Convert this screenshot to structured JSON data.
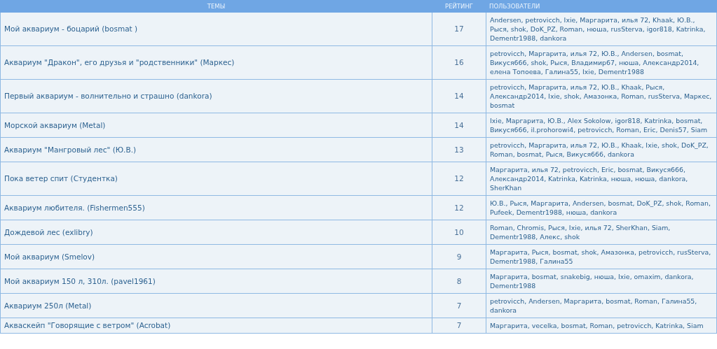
{
  "table": {
    "columns": [
      "ТЕМЫ",
      "РЕЙТИНГ",
      "ПОЛЬЗОВАТЕЛИ"
    ],
    "rows": [
      {
        "topic": "Мой аквариум - боцарий (bosmat )",
        "rating": "17",
        "users": "Andersen, petrovicch, Ixie, Маргарита, илья 72, Khaak, Ю.В., Рыся, shok, DoK_PZ, Roman, нюша, rusSterva, igor818, Katrinka, Dementr1988, dankora"
      },
      {
        "topic": "Аквариум \"Дракон\", его друзья и \"родственники\" (Маркес)",
        "rating": "16",
        "users": "petrovicch, Маргарита, илья 72, Ю.В., Andersen, bosmat, Викуся666, shok, Рыся, Владимир67, нюша, Александр2014, елена Топоева, Галина55, Ixie, Dementr1988"
      },
      {
        "topic": "Первый аквариум - волнительно и страшно (dankora)",
        "rating": "14",
        "users": "petrovicch, Маргарита, илья 72, Ю.В., Khaak, Рыся, Александр2014, Ixie, shok, Амазонка, Roman, rusSterva, Маркес, bosmat"
      },
      {
        "topic": "Морской аквариум (Metal)",
        "rating": "14",
        "users": "Ixie, Маргарита, Ю.В., Alex Sokolow, igor818, Katrinka, bosmat, Викуся666, il.prohorowi4, petrovicch, Roman, Eric, Denis57, Siam"
      },
      {
        "topic": "Аквариум \"Мангровый лес\" (Ю.В.)",
        "rating": "13",
        "users": "petrovicch, Маргарита, илья 72, Ю.В., Khaak, Ixie, shok, DoK_PZ, Roman, bosmat, Рыся, Викуся666, dankora"
      },
      {
        "topic": "Пока ветер спит (Студентка)",
        "rating": "12",
        "users": "Маргарита, илья 72, petrovicch, Eric, bosmat, Викуся666, Александр2014, Katrinka, Katrinka, нюша, нюша, dankora, SherKhan"
      },
      {
        "topic": "Аквариум любителя. (Fishermen555)",
        "rating": "12",
        "users": "Ю.В., Рыся, Маргарита, Andersen, bosmat, DoK_PZ, shok, Roman, Pufeek, Dementr1988, нюша, dankora"
      },
      {
        "topic": "Дождевой лес (exlibry)",
        "rating": "10",
        "users": "Roman, Chromis, Рыся, Ixie, илья 72, SherKhan, Siam, Dementr1988, Алекс, shok"
      },
      {
        "topic": "Мой аквариум (Smelov)",
        "rating": "9",
        "users": "Маргарита, Рыся, bosmat, shok, Амазонка, petrovicch, rusSterva, Dementr1988, Галина55"
      },
      {
        "topic": "Мой аквариум 150 л, 310л. (pavel1961)",
        "rating": "8",
        "users": "Маргарита, bosmat, snakebig, нюша, Ixie, omaxim, dankora, Dementr1988"
      },
      {
        "topic": "Аквариум 250л (Metal)",
        "rating": "7",
        "users": "petrovicch, Andersen, Маргарита, bosmat, Roman, Галина55, dankora"
      },
      {
        "topic": "Акваскейп \"Говорящие с ветром\" (Acrobat)",
        "rating": "7",
        "users": "Маргарита, vecelka, bosmat, Roman, petrovicch, Katrinka, Siam"
      }
    ]
  }
}
